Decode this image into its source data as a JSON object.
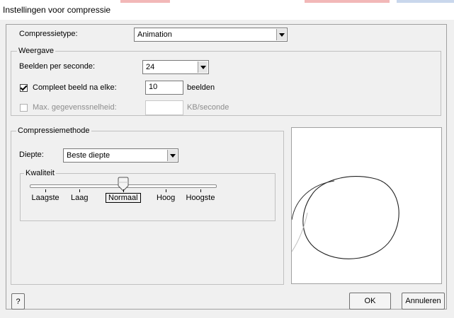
{
  "window": {
    "title": "Instellingen voor compressie"
  },
  "compression_type": {
    "label": "Compressietype:",
    "value": "Animation"
  },
  "display_group": {
    "title": "Weergave",
    "fps": {
      "label": "Beelden per seconde:",
      "value": "24"
    },
    "keyframe": {
      "label": "Compleet beeld na elke:",
      "checked": true,
      "value": "10",
      "unit": "beelden"
    },
    "datarate": {
      "label": "Max. gegevenssnelheid:",
      "checked": false,
      "enabled": false,
      "value": "",
      "unit": "KB/seconde"
    }
  },
  "method_group": {
    "title": "Compressiemethode",
    "depth": {
      "label": "Diepte:",
      "value": "Beste diepte"
    },
    "quality": {
      "title": "Kwaliteit",
      "levels": [
        "Laagste",
        "Laag",
        "Normaal",
        "Hoog",
        "Hoogste"
      ],
      "selected_index": 2
    }
  },
  "buttons": {
    "help": "?",
    "ok": "OK",
    "cancel": "Annuleren"
  }
}
